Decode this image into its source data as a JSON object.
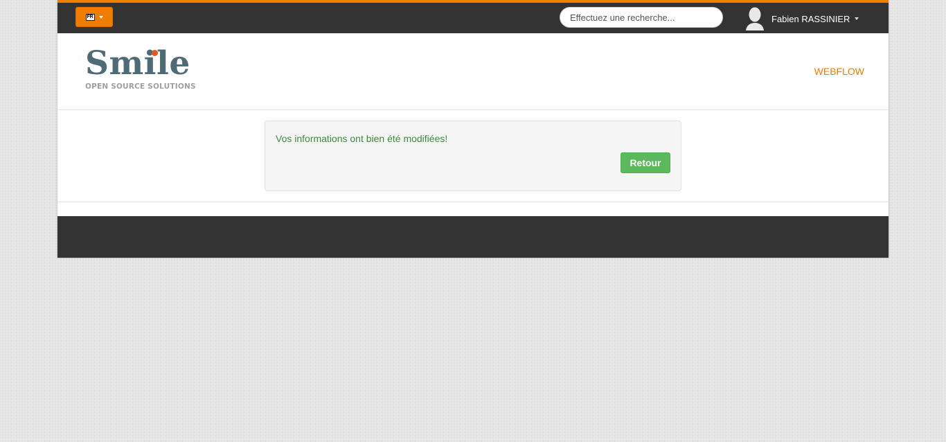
{
  "topbar": {
    "language_code": "FR",
    "search_placeholder": "Effectuez une recherche...",
    "user_name": "Fabien RASSINIER",
    "accent_color": "#f07c00"
  },
  "header": {
    "logo_word": "Smile",
    "logo_tagline": "OPEN SOURCE SOLUTIONS",
    "nav_link": "WEBFLOW"
  },
  "alert": {
    "message": "Vos informations ont bien été modifiées!",
    "button_label": "Retour",
    "button_color": "#5cb85c"
  },
  "icons": {
    "language": "flag-icon",
    "dropdown": "caret-down-icon",
    "user": "user-avatar-icon"
  }
}
